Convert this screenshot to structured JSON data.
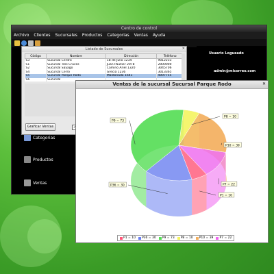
{
  "main_window": {
    "title": "Centro de control",
    "menu": [
      "Archivo",
      "Clientes",
      "Sucursales",
      "Productos",
      "Categorias",
      "Ventas",
      "Ayuda"
    ],
    "user_label": "Usuario Logueado",
    "user_email": "admin@micorreo.com",
    "sidebar": [
      "Categorias",
      "Productos",
      "Ventas"
    ]
  },
  "list_window": {
    "title": "Listado de Sucursales",
    "columns": [
      "Código",
      "Nombre",
      "Dirección",
      "Teléfono"
    ],
    "rows": [
      [
        "S3",
        "Sucursal Centro",
        "18 de Julio 1234",
        "9012233"
      ],
      [
        "S1",
        "Sucursal Tres Cruces",
        "Juan Paullier 2078",
        "2000000"
      ],
      [
        "S2",
        "Sucursal Sayago",
        "Camino Ariel 1320",
        "3045706"
      ],
      [
        "S4",
        "Sucursal Cerro",
        "Grecia 1236",
        "3013365"
      ],
      [
        "S5",
        "Sucursal Parque Rodo",
        "Maldonado 1641",
        "4097755"
      ],
      [
        "S6",
        "Sucursal",
        "",
        ""
      ]
    ],
    "selected_row": 4,
    "graph_button": "Graficar Ventas"
  },
  "chart_window": {
    "title": "Ventas de la sucursal Sucursal Parque Rodo"
  },
  "chart_data": {
    "type": "pie",
    "title": "Ventas de la sucursal Sucursal Parque Rodo",
    "slices": [
      {
        "label": "P1",
        "value": 10,
        "color": "#ff5577"
      },
      {
        "label": "P36",
        "value": 30,
        "color": "#6a7ff0"
      },
      {
        "label": "P9",
        "value": 73,
        "color": "#55dd55"
      },
      {
        "label": "P8",
        "value": 10,
        "color": "#f4f460"
      },
      {
        "label": "P10",
        "value": 39,
        "color": "#f3ae5c"
      },
      {
        "label": "P7",
        "value": 22,
        "color": "#ee66ee"
      }
    ],
    "slice_labels": [
      "P9 = 73",
      "P8 = 10",
      "P10 = 39",
      "P7 = 22",
      "P1 = 10",
      "P36 = 30"
    ],
    "legend": [
      "P1 = 10",
      "P36 = 30",
      "P9 = 73",
      "P8 = 10",
      "P10 = 39",
      "P7 = 22"
    ]
  }
}
